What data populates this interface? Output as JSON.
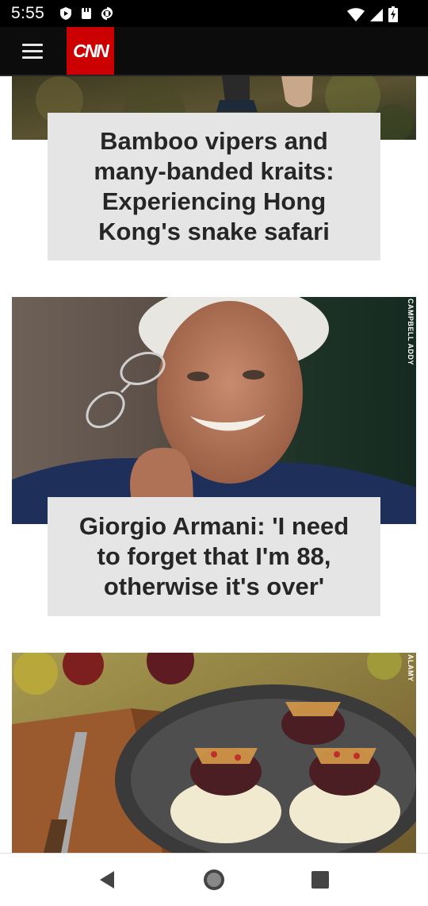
{
  "status_bar": {
    "time": "5:55",
    "icons_left": [
      "shield-play-icon",
      "cloud-save-icon",
      "sim-transfer-icon"
    ],
    "icons_right": [
      "wifi-icon",
      "cell-signal-icon",
      "battery-charging-icon"
    ]
  },
  "header": {
    "menu_icon": "hamburger-menu-icon",
    "logo_text": "CNN",
    "brand_color": "#cc0000"
  },
  "articles": [
    {
      "headline": "Bamboo vipers and many-banded kraits: Experiencing Hong Kong's snake safari",
      "photo_credit": ""
    },
    {
      "headline": "Giorgio Armani: 'I need to forget that I'm 88, otherwise it's over'",
      "photo_credit": "CAMPBELL ADDY"
    },
    {
      "headline": "",
      "photo_credit": "ALAMY"
    }
  ],
  "nav_bar": {
    "buttons": [
      "back-icon",
      "home-icon",
      "recents-icon"
    ]
  },
  "colors": {
    "headline_box_bg": "#e5e5e5",
    "headline_text": "#262626",
    "header_bg": "#0c0c0c"
  }
}
